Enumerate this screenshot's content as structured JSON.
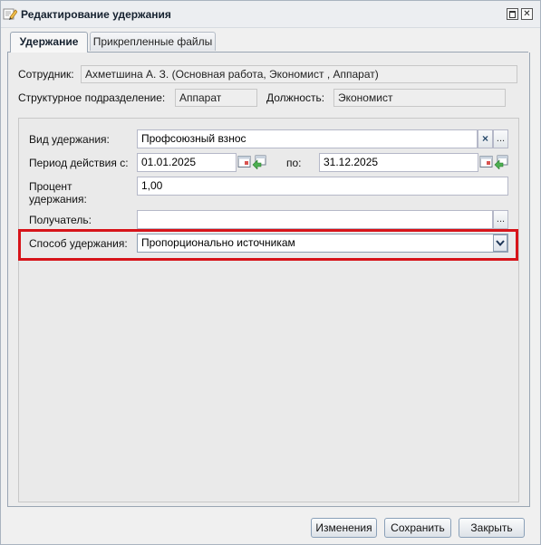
{
  "window": {
    "title": "Редактирование удержания"
  },
  "tabs": [
    {
      "label": "Удержание",
      "active": true
    },
    {
      "label": "Прикрепленные файлы",
      "active": false
    }
  ],
  "header_fields": {
    "employee_label": "Сотрудник:",
    "employee_value": "Ахметшина А. З. (Основная работа, Экономист , Аппарат)",
    "department_label": "Структурное подразделение:",
    "department_value": "Аппарат",
    "position_label": "Должность:",
    "position_value": "Экономист"
  },
  "form": {
    "deduction_type_label": "Вид удержания:",
    "deduction_type_value": "Профсоюзный взнос",
    "period_label": "Период действия с:",
    "period_from": "01.01.2025",
    "period_to_label": "по:",
    "period_to": "31.12.2025",
    "percent_label_line1": "Процент",
    "percent_label_line2": "удержания:",
    "percent_value": "1,00",
    "recipient_label": "Получатель:",
    "recipient_value": "",
    "method_label": "Способ удержания:",
    "method_value": "Пропорционально источникам"
  },
  "buttons": {
    "changes": "Изменения",
    "save": "Сохранить",
    "close": "Закрыть"
  },
  "icons": {
    "clear": "×",
    "ellipsis": "...",
    "dropdown": "chevron-down-icon"
  },
  "colors": {
    "highlight": "#d7141a"
  }
}
